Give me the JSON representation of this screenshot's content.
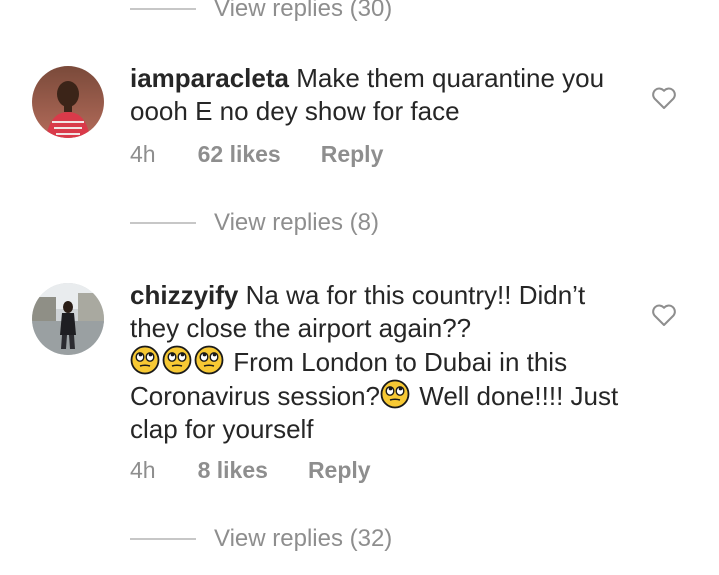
{
  "thread": {
    "top_view_replies": "View replies (30)",
    "comments": [
      {
        "username": "iamparacleta",
        "text": "Make them quarantine you oooh E no dey show for face",
        "time": "4h",
        "likes": "62 likes",
        "reply_label": "Reply",
        "view_replies": "View replies (8)",
        "avatar_icon": "avatar-photo-woman-red-dress"
      },
      {
        "username": "chizzyify",
        "text_1": "Na wa for this country!! Didn’t they  close the airport again??",
        "text_2": "From London to Dubai in this Coronavirus session?",
        "text_3": "Well done!!!! Just clap for yourself",
        "emoji": "face-with-rolling-eyes",
        "time": "4h",
        "likes": "8 likes",
        "reply_label": "Reply",
        "view_replies": "View replies (32)",
        "avatar_icon": "avatar-photo-person-street"
      }
    ]
  },
  "colors": {
    "text_primary": "#262626",
    "text_secondary": "#8e8e8e",
    "divider": "#c7c7c7",
    "emoji_face": "#f7c934"
  },
  "icons": {
    "like": "heart-outline-icon"
  }
}
